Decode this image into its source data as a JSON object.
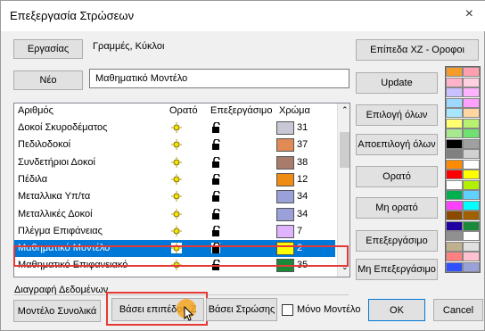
{
  "window": {
    "title": "Επεξεργασία Στρώσεων",
    "close": "×"
  },
  "ergasias": {
    "button": "Εργασίας",
    "value": "Γραμμές, Κύκλοι"
  },
  "neo": {
    "button": "Νέο",
    "value": "Μαθηματικό Μοντέλο"
  },
  "columns": {
    "name": "Αριθμός",
    "visible": "Ορατό",
    "editable": "Επεξεργάσιμο",
    "color": "Χρώμα"
  },
  "rows": [
    {
      "name": "Δοκοί Σκυροδέματος",
      "color": "#c8c8d4",
      "num": "31",
      "selected": false
    },
    {
      "name": "Πεδιλοδοκοί",
      "color": "#e08a55",
      "num": "37",
      "selected": false
    },
    {
      "name": "Συνδετήριοι Δοκοί",
      "color": "#a87b6b",
      "num": "38",
      "selected": false
    },
    {
      "name": "Πέδιλα",
      "color": "#ef8c14",
      "num": "12",
      "selected": false
    },
    {
      "name": "Μεταλλικα Υπ/τα",
      "color": "#9aa0d8",
      "num": "34",
      "selected": false
    },
    {
      "name": "Μεταλλικές Δοκοί",
      "color": "#9aa0d8",
      "num": "34",
      "selected": false
    },
    {
      "name": "Πλέγμα Επιφάνειας",
      "color": "#e0b3ff",
      "num": "7",
      "selected": false
    },
    {
      "name": "Μαθηματικό Μοντέλο",
      "color": "#ffff00",
      "num": "2",
      "selected": true
    },
    {
      "name": "Μαθηματικό Επιφανειακό",
      "color": "#1a8a3a",
      "num": "35",
      "selected": false
    }
  ],
  "right_buttons": {
    "xz": "Επίπεδα XZ - Οροφοι",
    "update": "Update",
    "select_all": "Επιλογή όλων",
    "deselect_all": "Αποεπιλογή όλων",
    "visible": "Ορατό",
    "not_visible": "Μη ορατό",
    "editable": "Επεξεργάσιμο",
    "not_editable": "Μη Επεξεργάσιμο"
  },
  "delete_section": {
    "label": "Διαγραφή Δεδομένων",
    "model_total": "Μοντέλο Συνολικά",
    "by_level": "Βάσει επιπέδου Ζ",
    "by_layer": "Βάσει Στρώσης",
    "only_model": "Μόνο Μοντέλο"
  },
  "footer": {
    "ok": "OK",
    "cancel": "Cancel"
  },
  "palette_colors": [
    [
      "#f39b2b",
      "#ff9fb0"
    ],
    [
      "#ffb3c8",
      "#ffd0e0"
    ],
    [
      "#c8c0ff",
      "#ffb3ff"
    ],
    [
      "#9fd8ff",
      "#ffa0ff"
    ],
    [
      "#a8e6ff",
      "#ffd6a0"
    ],
    [
      "#ffff70",
      "#b8f070"
    ],
    [
      "#a8e890",
      "#70e070"
    ],
    [
      "#000000",
      "#a0a0a0"
    ],
    [
      "#808080",
      "#d0d0d0"
    ],
    [
      "#ff8c00",
      "#ffffff"
    ],
    [
      "#ff0000",
      "#ffff00"
    ],
    [
      "#ffffff",
      "#b0f000"
    ],
    [
      "#00b050",
      "#60d0ff"
    ],
    [
      "#ff40ff",
      "#00ffff"
    ],
    [
      "#8b4a00",
      "#a06000"
    ],
    [
      "#2000a0",
      "#1a8a3a"
    ],
    [
      "#909090",
      "#ffffff"
    ],
    [
      "#c0b090",
      "#e0e0e0"
    ],
    [
      "#ff8080",
      "#ffc0d0"
    ],
    [
      "#3050ff",
      "#9aa0d8"
    ]
  ]
}
